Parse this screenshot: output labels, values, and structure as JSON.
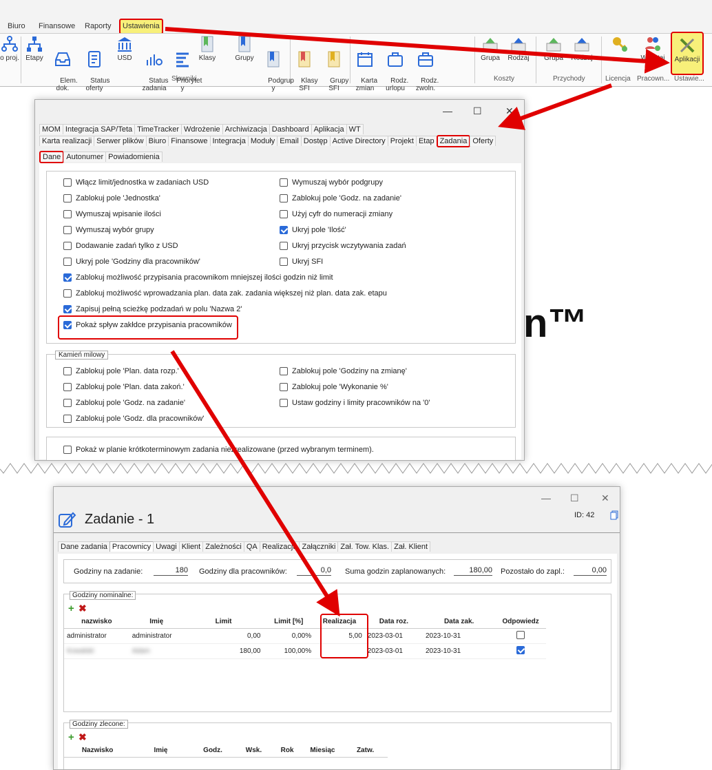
{
  "menu": {
    "items": [
      "Biuro",
      "Finansowe",
      "Raporty"
    ],
    "active": "Ustawienia"
  },
  "ribbon": {
    "buttons": {
      "proj": "o proj.",
      "etapy": "Etapy",
      "elem_dok": "Elem.\ndok.",
      "status_oferty": "Status\noferty",
      "usd": "USD",
      "status_zadania": "Status\nzadania",
      "priorytety": "Priorytet\ny",
      "klasy": "Klasy",
      "grupy": "Grupy",
      "podgrupy": "Podgrup\ny",
      "klasy_sfi": "Klasy\nSFI",
      "grupy_sfi": "Grupy\nSFI",
      "karta_zmian": "Karta\nzmian",
      "rodz_urlopu": "Rodz.\nurlopu",
      "rodz_zwoln": "Rodz.\nzwoln.",
      "koszty_grupa": "Grupa",
      "koszty_rodzaj": "Rodzaj",
      "przychody_grupa": "Grupa",
      "przychody_rodzaj": "Rodzaj",
      "wczytaj": "Wczytaj",
      "aplikacji": "Aplikacji"
    },
    "groups": {
      "slowniki": "Słowniki",
      "koszty": "Koszty",
      "przychody": "Przychody",
      "licencja": "Licencja",
      "pracown": "Pracown...",
      "ustawie": "Ustawie..."
    }
  },
  "settings": {
    "window_buttons": {
      "min": "—",
      "max": "☐",
      "close": "✕"
    },
    "tabs_row1": [
      "MOM",
      "Integracja SAP/Teta",
      "TimeTracker",
      "Wdrożenie",
      "Archiwizacja",
      "Dashboard",
      "Aplikacja",
      "WT"
    ],
    "tabs_row2": [
      "Karta realizacji",
      "Serwer plików",
      "Biuro",
      "Finansowe",
      "Integracja",
      "Moduły",
      "Email",
      "Dostęp",
      "Active Directory",
      "Projekt",
      "Etap",
      "Zadania",
      "Oferty"
    ],
    "subtabs": [
      "Dane",
      "Autonumer",
      "Powiadomienia"
    ],
    "options_left": [
      {
        "label": "Włącz limit/jednostka w zadaniach USD",
        "checked": false
      },
      {
        "label": "Zablokuj pole 'Jednostka'",
        "checked": false
      },
      {
        "label": "Wymuszaj wpisanie ilości",
        "checked": false
      },
      {
        "label": "Wymuszaj wybór grupy",
        "checked": false
      },
      {
        "label": "Dodawanie zadań tylko z USD",
        "checked": false
      },
      {
        "label": "Ukryj pole 'Godziny dla pracowników'",
        "checked": false
      }
    ],
    "options_right": [
      {
        "label": "Wymuszaj wybór podgrupy",
        "checked": false
      },
      {
        "label": "Zablokuj pole 'Godz. na zadanie'",
        "checked": false
      },
      {
        "label": "Użyj cyfr do numeracji zmiany",
        "checked": false
      },
      {
        "label": "Ukryj pole 'Ilość'",
        "checked": true
      },
      {
        "label": "Ukryj przycisk wczytywania zadań",
        "checked": false
      },
      {
        "label": "Ukryj SFI",
        "checked": false
      }
    ],
    "options_full": [
      {
        "label": "Zablokuj możliwość przypisania pracownikom mniejszej ilości godzin niż limit",
        "checked": true
      },
      {
        "label": "Zablokuj możliwość wprowadzania plan. data zak. zadania większej niż plan. data zak. etapu",
        "checked": false
      },
      {
        "label": "Zapisuj pełną scieżkę podzadań w polu 'Nazwa 2'",
        "checked": true
      },
      {
        "label": "Pokaż spływ zakłdce przypisania pracowników",
        "checked": true
      }
    ],
    "milestone": {
      "title": "Kamień milowy",
      "left": [
        {
          "label": "Zablokuj pole 'Plan. data rozp.'",
          "checked": false
        },
        {
          "label": "Zablokuj pole 'Plan. data zakoń.'",
          "checked": false
        },
        {
          "label": "Zablokuj pole 'Godz. na zadanie'",
          "checked": false
        },
        {
          "label": "Zablokuj pole 'Godz. dla pracowników'",
          "checked": false
        }
      ],
      "right": [
        {
          "label": "Zablokuj pole 'Godziny na zmianę'",
          "checked": false
        },
        {
          "label": "Zablokuj pole 'Wykonanie %'",
          "checked": false
        },
        {
          "label": "Ustaw godziny i limity pracowników na '0'",
          "checked": false
        }
      ]
    },
    "bottom_option": {
      "label": "Pokaż w planie krótkoterminowym zadania niezrealizowane (przed wybranym terminem).",
      "checked": false
    }
  },
  "background_text": "n™",
  "task": {
    "window_buttons": {
      "min": "—",
      "max": "☐",
      "close": "✕"
    },
    "title": "Zadanie - 1",
    "id_label": "ID: 42",
    "tabs": [
      "Dane zadania",
      "Pracownicy",
      "Uwagi",
      "Klient",
      "Zależności",
      "QA",
      "Realizacja",
      "Załączniki",
      "Zał. Tow. Klas.",
      "Zał. Klient"
    ],
    "summary": {
      "godziny_na_zadanie_label": "Godziny na zadanie:",
      "godziny_na_zadanie": "180",
      "godziny_dla_prac_label": "Godziny dla pracowników:",
      "godziny_dla_prac": "0,0",
      "suma_label": "Suma godzin zaplanowanych:",
      "suma": "180,00",
      "pozostalo_label": "Pozostało do zapl.:",
      "pozostalo": "0,00"
    },
    "nominal": {
      "title": "Godziny nominalne:",
      "headers": [
        "nazwisko",
        "Imię",
        "Limit",
        "Limit [%]",
        "Realizacja",
        "Data roz.",
        "Data zak.",
        "Odpowiedz"
      ],
      "rows": [
        {
          "nazwisko": "administrator",
          "imie": "administrator",
          "limit": "0,00",
          "limit_pct": "0,00%",
          "realizacja": "5,00",
          "data_roz": "2023-03-01",
          "data_zak": "2023-10-31",
          "odp": false
        },
        {
          "nazwisko": "Kowalski",
          "imie": "Adam",
          "limit": "180,00",
          "limit_pct": "100,00%",
          "realizacja": "",
          "data_roz": "2023-03-01",
          "data_zak": "2023-10-31",
          "odp": true
        }
      ]
    },
    "ordered": {
      "title": "Godziny zlecone:",
      "headers": [
        "Nazwisko",
        "Imię",
        "Godz.",
        "Wsk.",
        "Rok",
        "Miesiąc",
        "Zatw."
      ]
    }
  },
  "colors": {
    "highlight": "#e00000",
    "yellow": "#f8f07a",
    "accent": "#2a6ad8"
  }
}
